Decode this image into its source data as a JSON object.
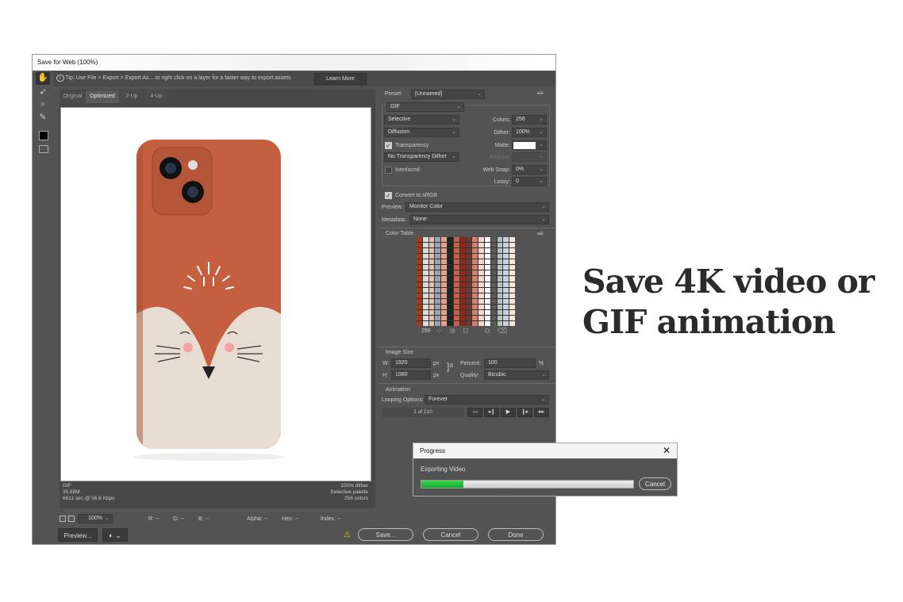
{
  "dialog": {
    "title": "Save for Web (100%)",
    "tip": "Tip: Use File > Export > Export As...  or right click on a layer for a faster way to export assets",
    "learn_more": "Learn More",
    "tabs": [
      "Original",
      "Optimized",
      "2-Up",
      "4-Up"
    ],
    "active_tab": "Optimized",
    "tools": [
      "hand-icon",
      "slice-select-icon",
      "zoom-icon",
      "eyedropper-icon"
    ],
    "info_left": [
      "GIF",
      "35.68M",
      "6611 sec @ 56.6 Kbps"
    ],
    "info_right": [
      "100% dither",
      "Selective palette",
      "256 colors"
    ],
    "zoom": "100%",
    "status": {
      "r": "R: --",
      "g": "G: --",
      "b": "B: --",
      "alpha": "Alpha: --",
      "hex": "Hex: --",
      "index": "Index: --"
    },
    "preview_btn": "Preview...",
    "save_btn": "Save...",
    "cancel_btn": "Cancel",
    "done_btn": "Done",
    "warning_color": "#f5c400"
  },
  "settings": {
    "preset_label": "Preset:",
    "preset": "[Unnamed]",
    "format": "GIF",
    "reduction": "Selective",
    "dither_algo": "Diffusion",
    "transparency_label": "Transparency",
    "transparency": true,
    "trans_dither": "No Transparency Dither",
    "interlaced_label": "Interlaced",
    "interlaced": false,
    "colors_label": "Colors:",
    "colors": "256",
    "dither_label": "Dither:",
    "dither": "100%",
    "matte_label": "Matte:",
    "amount_label": "Amount:",
    "websnap_label": "Web Snap:",
    "websnap": "0%",
    "lossy_label": "Lossy:",
    "lossy": "0",
    "srgb_label": "Convert to sRGB",
    "srgb": true,
    "preview_label": "Preview:",
    "preview": "Monitor Color",
    "metadata_label": "Metadata:",
    "metadata": "None"
  },
  "color_table": {
    "title": "Color Table",
    "count": "256"
  },
  "image_size": {
    "title": "Image Size",
    "w_label": "W:",
    "w": "1920",
    "h_label": "H:",
    "h": "1080",
    "unit": "px",
    "percent_label": "Percent:",
    "percent": "100",
    "pct": "%",
    "quality_label": "Quality:",
    "quality": "Bicubic"
  },
  "animation": {
    "title": "Animation",
    "looping_label": "Looping Options:",
    "looping": "Forever",
    "frame": "1 of 210"
  },
  "progress": {
    "title": "Progress",
    "message": "Exporting Video",
    "value": 0.2,
    "cancel": "Cancel",
    "bar_color": "#22c03a"
  },
  "headline": "Save 4K video or GIF animation"
}
